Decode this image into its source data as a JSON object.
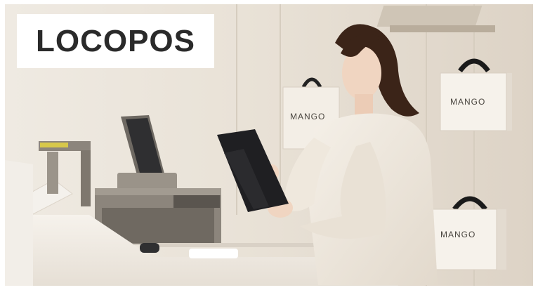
{
  "brand": {
    "logo_text": "LOCOPOS"
  },
  "scene": {
    "bag_labels": [
      "MANGO",
      "MANGO",
      "MANGO"
    ],
    "colors": {
      "wall": "#ece6dc",
      "counter": "#f3efe8",
      "sweater": "#f1ebe2",
      "hair": "#3b2418",
      "tablet": "#1f1f22",
      "register": "#8c857c"
    }
  }
}
